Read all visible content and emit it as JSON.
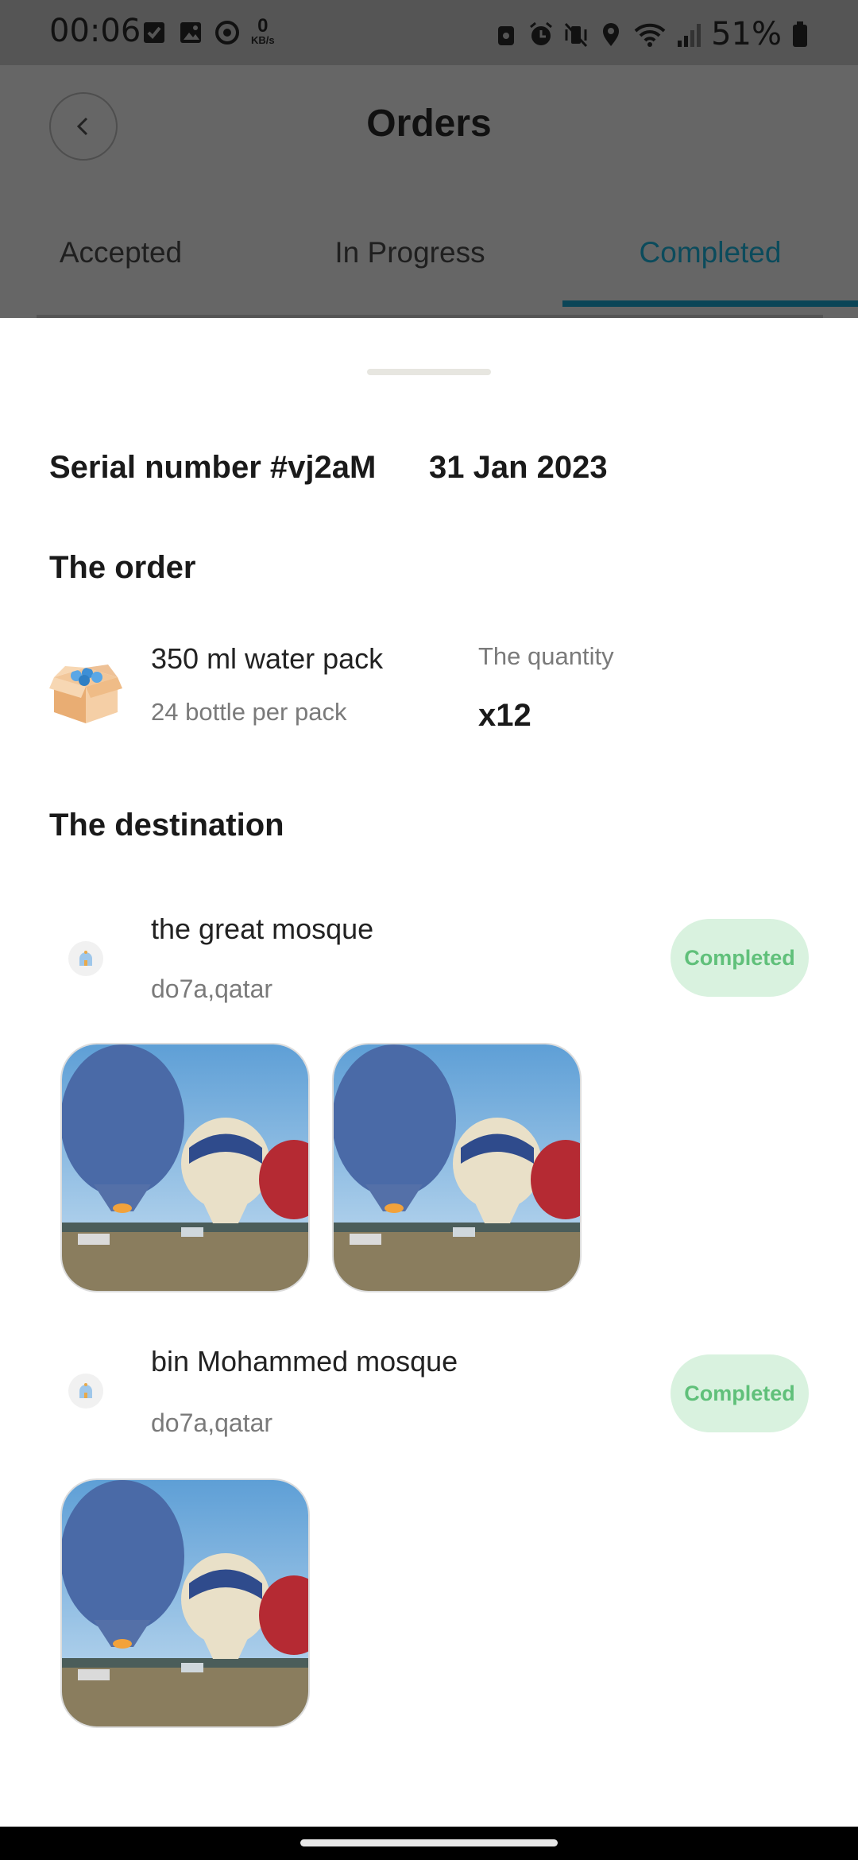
{
  "status_bar": {
    "time": "00:06",
    "speed_value": "0",
    "speed_unit": "KB/s",
    "battery": "51%"
  },
  "header": {
    "title": "Orders",
    "tabs": [
      {
        "label": "Accepted",
        "active": false
      },
      {
        "label": "In Progress",
        "active": false
      },
      {
        "label": "Completed",
        "active": true
      }
    ]
  },
  "order": {
    "serial": "Serial number #vj2aM",
    "date": "31 Jan 2023",
    "section_title": "The order",
    "item": {
      "name": "350 ml water pack",
      "description": "24 bottle per pack",
      "quantity_label": "The quantity",
      "quantity": "x12"
    }
  },
  "destination": {
    "section_title": "The destination",
    "items": [
      {
        "name": "the great mosque",
        "location": "do7a,qatar",
        "status": "Completed",
        "photo_count": 2
      },
      {
        "name": "bin Mohammed mosque",
        "location": "do7a,qatar",
        "status": "Completed",
        "photo_count": 1
      }
    ]
  },
  "colors": {
    "active_tab": "#0b4b5c",
    "badge_bg": "#d9f2df",
    "badge_text": "#60c07a"
  }
}
